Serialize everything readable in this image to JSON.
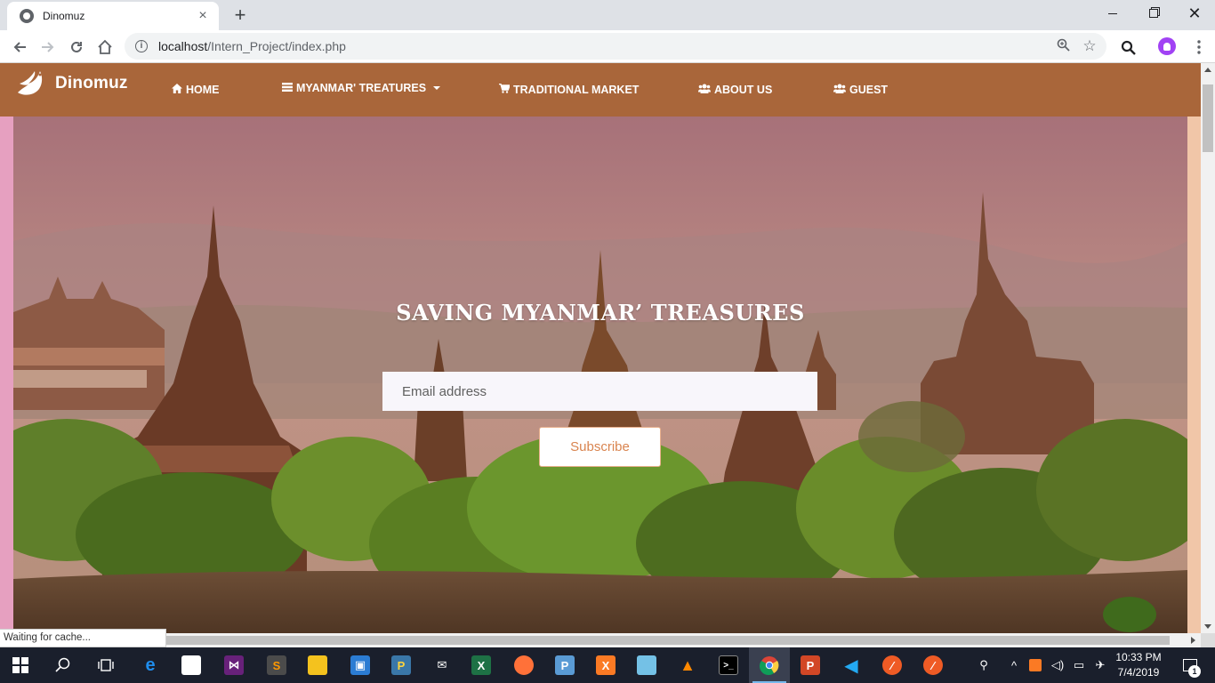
{
  "browser": {
    "tab_title": "Dinomuz",
    "tab_close": "×",
    "new_tab": "+",
    "url_host": "localhost",
    "url_path": "/Intern_Project/index.php",
    "status_text": "Waiting for cache...",
    "win_close": "✕"
  },
  "site": {
    "brand": "Dinomuz",
    "nav": [
      {
        "label": "HOME",
        "icon": "home-icon"
      },
      {
        "label": "MYANMAR' TREATURES",
        "icon": "list-icon",
        "has_dropdown": true
      },
      {
        "label": "TRADITIONAL MARKET",
        "icon": "shopping-cart-icon"
      },
      {
        "label": "ABOUT US",
        "icon": "users-icon"
      },
      {
        "label": "GUEST",
        "icon": "users-icon"
      }
    ],
    "nav_bg": "#a9663a",
    "hero": {
      "title": "SAVING MYANMAR’ TREASURES",
      "email_placeholder": "Email address",
      "subscribe_label": "Subscribe",
      "subscribe_color": "#d9844f"
    }
  },
  "taskbar": {
    "time": "10:33 PM",
    "date": "7/4/2019",
    "notification_count": "1",
    "apps": [
      "start-icon",
      "search-icon",
      "task-view-icon",
      "edge-icon",
      "store-icon",
      "visual-studio-icon",
      "sublime-icon",
      "file-explorer-icon",
      "outlook-icon",
      "python-icon",
      "mail-icon",
      "excel-icon",
      "firefox-icon",
      "python-editor-icon",
      "xampp-icon",
      "notepad-icon",
      "vlc-icon",
      "terminal-icon",
      "chrome-icon",
      "powerpoint-icon",
      "vscode-icon",
      "postman-icon",
      "postman-alt-icon"
    ]
  }
}
